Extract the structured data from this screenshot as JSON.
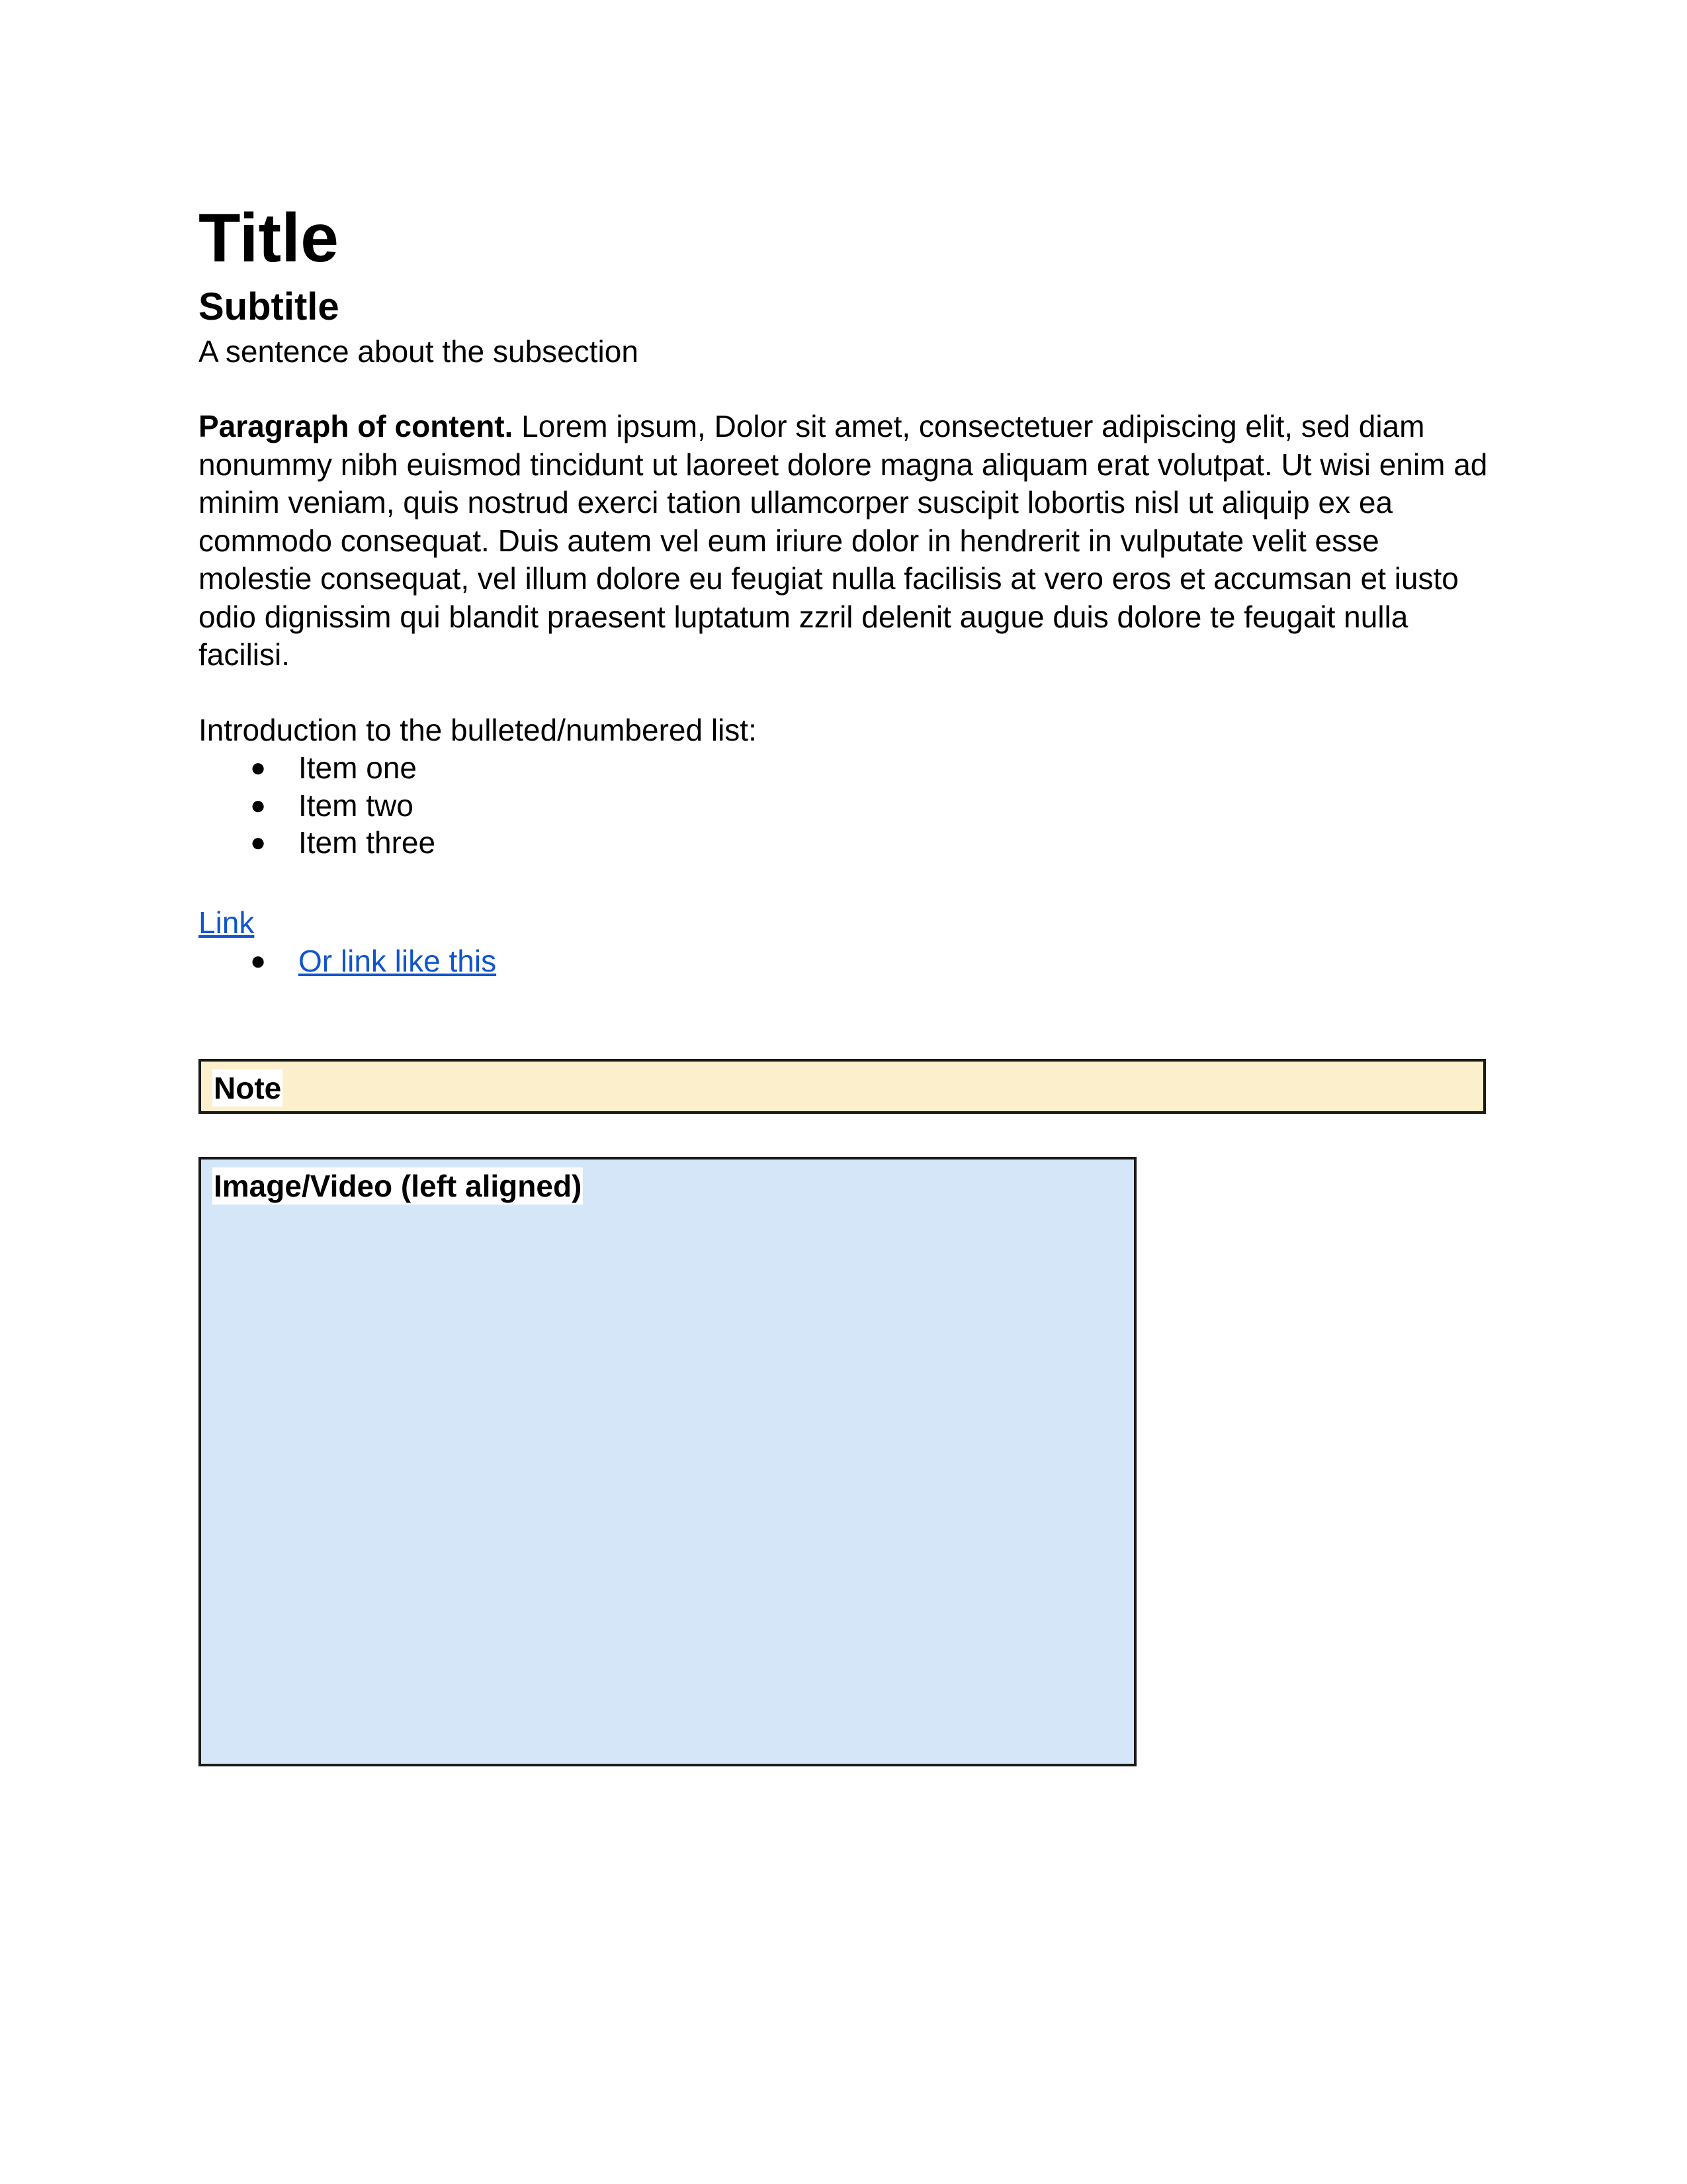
{
  "document": {
    "title": "Title",
    "subtitle": "Subtitle",
    "subsection_sentence": "A sentence about the subsection",
    "paragraph": {
      "lead": "Paragraph of content.",
      "lines": [
        " Lorem ipsum, Dolor sit amet, consectetuer adipiscing elit, sed diam",
        "nonummy nibh euismod tincidunt ut laoreet dolore magna aliquam erat volutpat. Ut wisi enim ad",
        "minim veniam, quis nostrud exerci tation ullamcorper suscipit lobortis nisl ut aliquip ex ea",
        "commodo consequat. Duis autem vel eum iriure dolor in hendrerit in vulputate velit esse",
        "molestie consequat, vel illum dolore eu feugiat nulla facilisis at vero eros et accumsan et iusto",
        "odio dignissim qui blandit praesent luptatum zzril delenit augue duis dolore te feugait nulla",
        "facilisi."
      ]
    },
    "list_intro": "Introduction to the bulleted/numbered list:",
    "list_items": [
      "Item one",
      "Item two",
      "Item three"
    ],
    "bullet_glyph": "●",
    "link": "Link",
    "sub_link": "Or link like this",
    "note_label": "Note",
    "media_label": "Image/Video (left aligned)"
  },
  "colors": {
    "link": "#1155cc",
    "note_background": "#fcf0cc",
    "media_background": "#d5e6f8",
    "border": "#1a1a1a"
  }
}
